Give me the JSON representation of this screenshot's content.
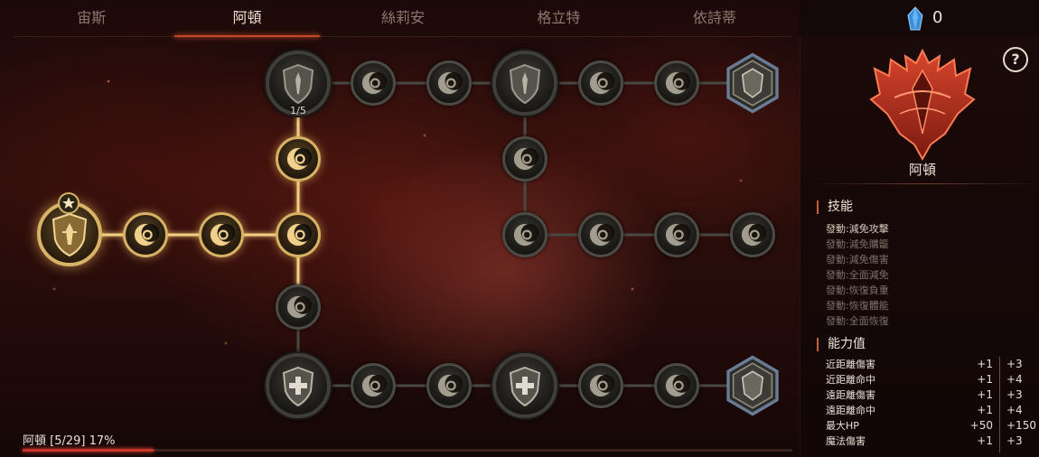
{
  "tabs": [
    {
      "label": "宙斯",
      "active": false
    },
    {
      "label": "阿頓",
      "active": true
    },
    {
      "label": "絲莉安",
      "active": false
    },
    {
      "label": "格立特",
      "active": false
    },
    {
      "label": "依詩蒂",
      "active": false
    }
  ],
  "currency": {
    "icon": "blue-crystal-icon",
    "count": "0"
  },
  "help_label": "?",
  "panel": {
    "emblem_icon": "red-winged-crest-icon",
    "name": "阿頓",
    "skills_title": "技能",
    "skills": [
      {
        "label": "發動:減免攻擊",
        "active": true
      },
      {
        "label": "發動:減免購籠",
        "active": false
      },
      {
        "label": "發動:減免傷害",
        "active": false
      },
      {
        "label": "發動:全面減免",
        "active": false
      },
      {
        "label": "發動:恢復負重",
        "active": false
      },
      {
        "label": "發動:恢復體能",
        "active": false
      },
      {
        "label": "發動:全面恢復",
        "active": false
      }
    ],
    "stats_title": "能力值",
    "stats": [
      {
        "label": "近距離傷害",
        "current": "+1",
        "next": "+3"
      },
      {
        "label": "近距離命中",
        "current": "+1",
        "next": "+4"
      },
      {
        "label": "遠距離傷害",
        "current": "+1",
        "next": "+3"
      },
      {
        "label": "遠距離命中",
        "current": "+1",
        "next": "+4"
      },
      {
        "label": "最大HP",
        "current": "+50",
        "next": "+150"
      },
      {
        "label": "魔法傷害",
        "current": "+1",
        "next": "+3"
      }
    ]
  },
  "tree": {
    "rank_label": "1/5",
    "root_icon": "warrior-shield-icon",
    "crescent_icon": "crescent-moon-icon",
    "big_icons": [
      "knight-shield-icon",
      "cross-shield-icon",
      "crown-crest-icon"
    ]
  },
  "progress": {
    "label": "阿頓 [5/29] 17%",
    "fraction": 0.17
  },
  "colors": {
    "accent": "#c8462a",
    "gold": "#d7b264",
    "inactive": "#4b4a44"
  }
}
